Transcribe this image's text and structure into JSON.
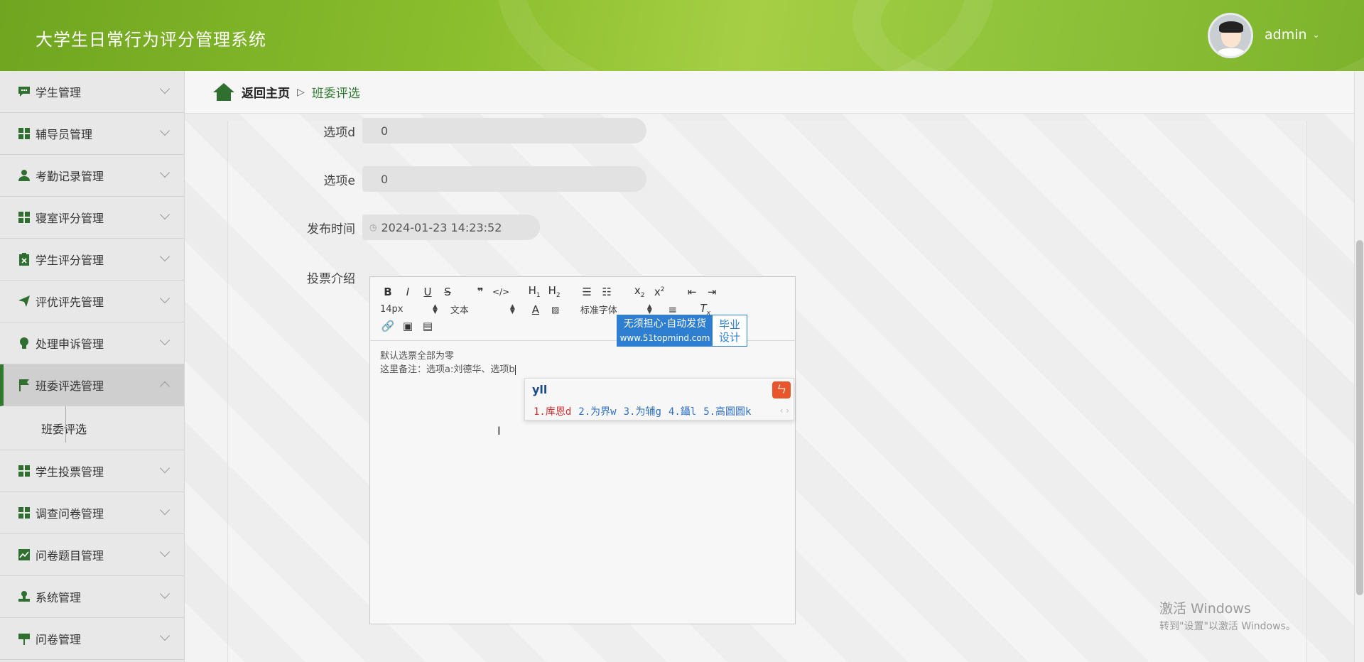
{
  "app": {
    "title": "大学生日常行为评分管理系统"
  },
  "user": {
    "name": "admin"
  },
  "breadcrumb": {
    "home": "返回主页",
    "separator": "▷",
    "current": "班委评选"
  },
  "sidebar": {
    "items": [
      {
        "label": "学生管理",
        "icon": "chat-icon"
      },
      {
        "label": "辅导员管理",
        "icon": "grid-icon"
      },
      {
        "label": "考勤记录管理",
        "icon": "user-icon"
      },
      {
        "label": "寝室评分管理",
        "icon": "grid-icon"
      },
      {
        "label": "学生评分管理",
        "icon": "clipboard-icon"
      },
      {
        "label": "评优评先管理",
        "icon": "send-icon"
      },
      {
        "label": "处理申诉管理",
        "icon": "bulb-icon"
      },
      {
        "label": "班委评选管理",
        "icon": "flag-icon",
        "active": true
      },
      {
        "label": "学生投票管理",
        "icon": "grid-icon"
      },
      {
        "label": "调查问卷管理",
        "icon": "grid-icon"
      },
      {
        "label": "问卷题目管理",
        "icon": "chart-icon"
      },
      {
        "label": "系统管理",
        "icon": "stamp-icon"
      },
      {
        "label": "问卷管理",
        "icon": "sign-icon"
      }
    ],
    "sub_item": "班委评选"
  },
  "form": {
    "option_d": {
      "label": "选项d",
      "value": "0"
    },
    "option_e": {
      "label": "选项e",
      "value": "0"
    },
    "publish_time": {
      "label": "发布时间",
      "value": "2024-01-23 14:23:52"
    },
    "intro": {
      "label": "投票介绍"
    }
  },
  "editor": {
    "font_size": "14px",
    "text_type": "文本",
    "font_family": "标准字体",
    "line1": "默认选票全部为零",
    "line2": "这里备注：选项a:刘德华、选项b"
  },
  "badge": {
    "line1": "无须担心·自动发货",
    "url": "www.51topmind.com",
    "right1": "毕业",
    "right2": "设计"
  },
  "ime": {
    "input": "yll",
    "candidates": [
      "1.库恩d",
      "2.为界w",
      "3.为辅g",
      "4.鑷l",
      "5.高圆圆k"
    ],
    "nav": "‹ ›"
  },
  "windows": {
    "line1": "激活 Windows",
    "line2": "转到\"设置\"以激活 Windows。"
  }
}
